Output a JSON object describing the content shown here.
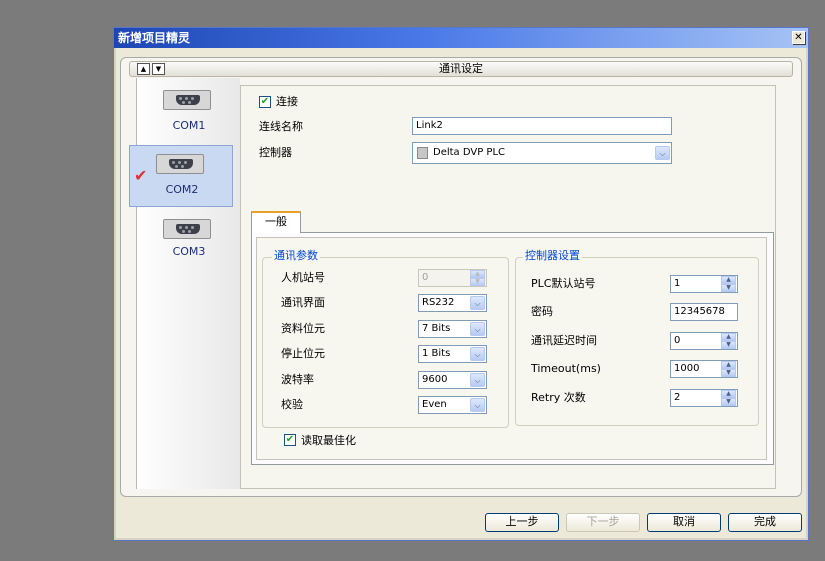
{
  "window": {
    "title": "新增项目精灵",
    "close_glyph": "✕"
  },
  "header": {
    "title": "通讯设定",
    "arrow_up": "▲",
    "arrow_down": "▼"
  },
  "sidebar": {
    "items": [
      {
        "label": "COM1",
        "selected": false
      },
      {
        "label": "COM2",
        "selected": true
      },
      {
        "label": "COM3",
        "selected": false
      }
    ],
    "selected_mark": "✔"
  },
  "connection": {
    "connect_checked": true,
    "connect_label": "连接",
    "name_label": "连线名称",
    "name_value": "Link2",
    "controller_label": "控制器",
    "controller_value": "Delta DVP PLC"
  },
  "tabs": {
    "general": "一般"
  },
  "comm_params": {
    "title": "通讯参数",
    "rows": [
      {
        "label": "人机站号",
        "value": "0",
        "kind": "spin-disabled"
      },
      {
        "label": "通讯界面",
        "value": "RS232",
        "kind": "combo"
      },
      {
        "label": "资料位元",
        "value": "7 Bits",
        "kind": "combo"
      },
      {
        "label": "停止位元",
        "value": "1 Bits",
        "kind": "combo"
      },
      {
        "label": "波特率",
        "value": "9600",
        "kind": "combo"
      },
      {
        "label": "校验",
        "value": "Even",
        "kind": "combo"
      }
    ],
    "optimize_checked": true,
    "optimize_label": "读取最佳化"
  },
  "controller_settings": {
    "title": "控制器设置",
    "rows": [
      {
        "label": "PLC默认站号",
        "value": "1",
        "kind": "spin"
      },
      {
        "label": "密码",
        "value": "12345678",
        "kind": "text"
      },
      {
        "label": "通讯延迟时间",
        "value": "0",
        "kind": "spin"
      },
      {
        "label": "Timeout(ms)",
        "value": "1000",
        "kind": "spin"
      },
      {
        "label": "Retry 次数",
        "value": "2",
        "kind": "spin"
      }
    ]
  },
  "buttons": {
    "prev": "上一步",
    "next": "下一步",
    "cancel": "取消",
    "finish": "完成"
  },
  "icons": {
    "combo_arrow": "⌵",
    "spin_up": "▲",
    "spin_down": "▼",
    "check": "✔"
  }
}
